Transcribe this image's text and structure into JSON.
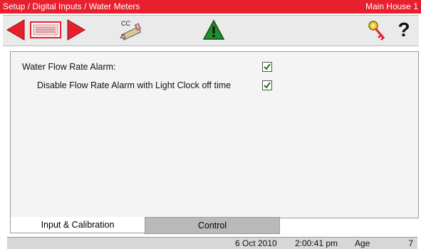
{
  "titlebar": {
    "path": "Setup / Digital Inputs / Water Meters",
    "house": "Main House 1"
  },
  "toolbar": {
    "buttons": [
      "back-arrow-icon",
      "keypad-icon",
      "forward-arrow-icon",
      "cc-pencil-icon",
      "alarm-warning-icon",
      "key-icon",
      "help-icon"
    ],
    "cc_label": "CC",
    "help_label": "?"
  },
  "settings": {
    "water_flow_rate_alarm": {
      "label": "Water Flow Rate Alarm:",
      "checked": true
    },
    "disable_flow_rate_alarm": {
      "label": "Disable Flow Rate Alarm with Light Clock off time",
      "checked": true
    }
  },
  "tabs": [
    {
      "label": "Input & Calibration",
      "active": true
    },
    {
      "label": "Control",
      "active": false
    }
  ],
  "status": {
    "date": "6 Oct 2010",
    "time": "2:00:41 pm",
    "age_label": "Age",
    "age_value": "7"
  },
  "colors": {
    "titlebar": "#e8202e",
    "arrow": "#e8202e",
    "warning": "#1f8f2a"
  }
}
